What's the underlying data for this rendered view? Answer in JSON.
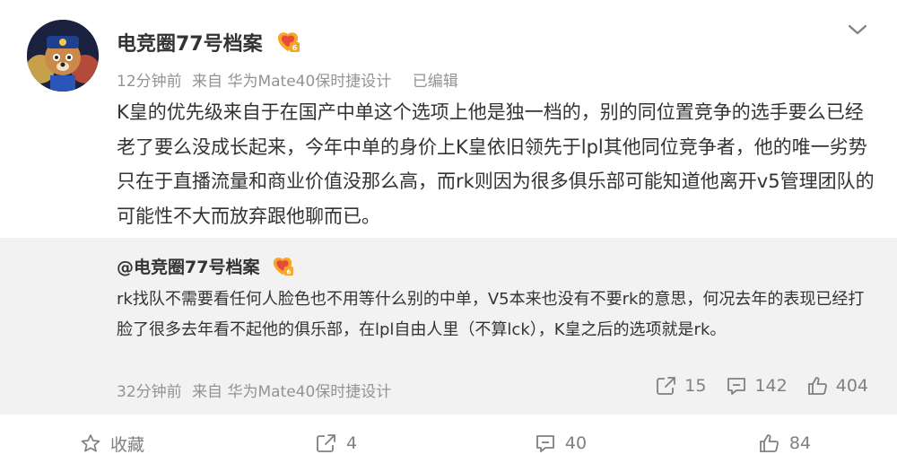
{
  "post": {
    "author": "电竞圈77号档案",
    "time": "12分钟前",
    "source": "来自 华为Mate40保时捷设计",
    "edited": "已编辑",
    "content": "K皇的优先级来自于在国产中单这个选项上他是独一档的，别的同位置竞争的选手要么已经老了要么没成长起来，今年中单的身价上K皇依旧领先于lpl其他同位竞争者，他的唯一劣势只在于直播流量和商业价值没那么高，而rk则因为很多俱乐部可能知道他离开v5管理团队的可能性不大而放弃跟他聊而已。"
  },
  "repost": {
    "author": "@电竞圈77号档案",
    "content": "rk找队不需要看任何人脸色也不用等什么别的中单，V5本来也没有不要rk的意思，何况去年的表现已经打脸了很多去年看不起他的俱乐部，在lpl自由人里（不算lck），K皇之后的选项就是rk。",
    "time": "32分钟前",
    "source": "来自 华为Mate40保时捷设计",
    "reposts": "15",
    "comments": "142",
    "likes": "404"
  },
  "footer": {
    "favorite": "收藏",
    "reposts": "4",
    "comments": "40",
    "likes": "84"
  },
  "icons": {
    "badge": "gold-v-badge-icon",
    "chevron": "chevron-down-icon",
    "share": "share-icon",
    "comment": "comment-icon",
    "like": "thumbs-up-icon",
    "favorite": "star-icon"
  },
  "colors": {
    "text": "#333333",
    "muted": "#939393",
    "repost_bg": "#f2f2f2",
    "badge_orange": "#f5a623"
  }
}
